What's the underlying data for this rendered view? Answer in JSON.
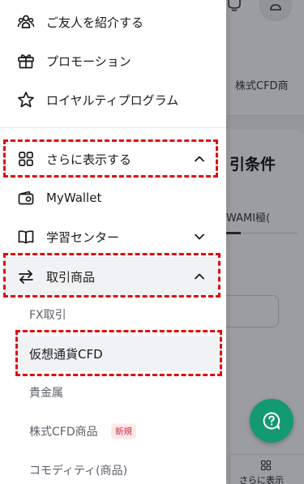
{
  "background": {
    "tab_partial": "株式CFD商",
    "card_title_partial": "引条件",
    "card_subtitle_partial": "WAMI極(",
    "more_button_label": "さらに表示"
  },
  "drawer": {
    "top_items": [
      {
        "label": "ご友人を紹介する",
        "icon": "people-icon"
      },
      {
        "label": "プロモーション",
        "icon": "gift-icon"
      },
      {
        "label": "ロイヤルティプログラム",
        "icon": "star-icon"
      }
    ],
    "more_section": {
      "label": "さらに表示する",
      "icon": "grid-icon",
      "expanded": true
    },
    "mywallet": {
      "label": "MyWallet",
      "icon": "wallet-icon"
    },
    "learning": {
      "label": "学習センター",
      "icon": "book-icon",
      "expanded": false
    },
    "products": {
      "label": "取引商品",
      "icon": "swap-arrows-icon",
      "expanded": true
    },
    "product_items": [
      {
        "label": "FX取引"
      },
      {
        "label": "仮想通貨CFD",
        "selected": true
      },
      {
        "label": "貴金属"
      },
      {
        "label": "株式CFD商品",
        "badge": "新規"
      },
      {
        "label": "コモディティ(商品)"
      }
    ]
  },
  "colors": {
    "highlight": "#e00e0e",
    "fab": "#139a6f",
    "badge_bg": "#fde9ec",
    "badge_text": "#d0273e"
  }
}
